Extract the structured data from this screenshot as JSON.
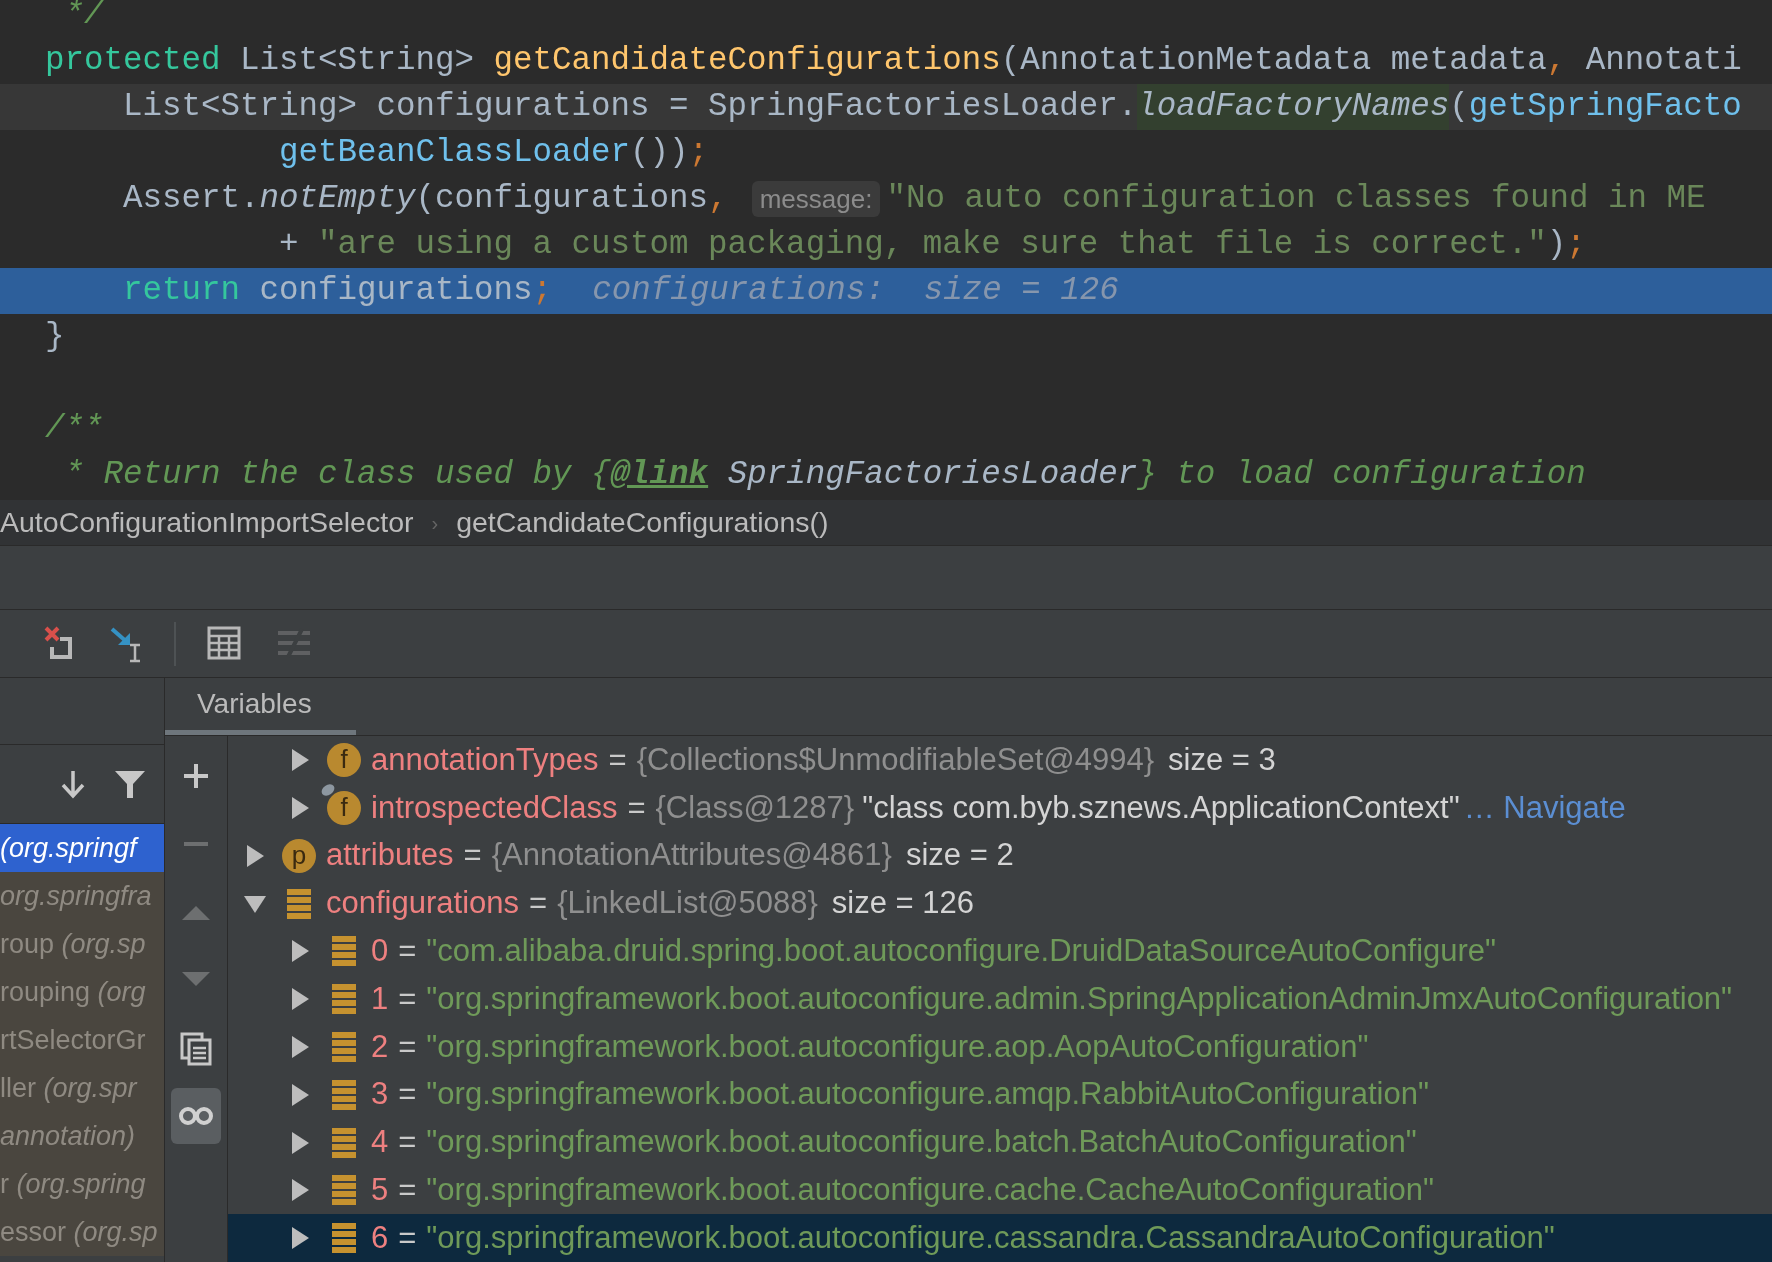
{
  "code": {
    "lines": [
      {
        "caret": false,
        "selected": false,
        "tokens": [
          {
            "kind": "comment",
            "text": " */"
          }
        ]
      },
      {
        "caret": false,
        "selected": false,
        "tokens": [
          {
            "kind": "keyword",
            "text": "protected"
          },
          {
            "kind": "plain",
            "text": " List<String> "
          },
          {
            "kind": "declaration",
            "text": "getCandidateConfigurations"
          },
          {
            "kind": "plain",
            "text": "(AnnotationMetadata metadata"
          },
          {
            "kind": "punct",
            "text": ","
          },
          {
            "kind": "plain",
            "text": " Annotati"
          }
        ]
      },
      {
        "caret": true,
        "selected": false,
        "tokens": [
          {
            "kind": "plain",
            "text": "    List<String> configurations = SpringFactoriesLoader."
          },
          {
            "kind": "italic-marked",
            "text": "loadFactoryNames"
          },
          {
            "kind": "plain",
            "text": "("
          },
          {
            "kind": "call",
            "text": "getSpringFacto"
          }
        ]
      },
      {
        "caret": false,
        "selected": false,
        "tokens": [
          {
            "kind": "call",
            "text": "            getBeanClassLoader"
          },
          {
            "kind": "plain",
            "text": "())"
          },
          {
            "kind": "punct",
            "text": ";"
          }
        ]
      },
      {
        "caret": false,
        "selected": false,
        "tokens": [
          {
            "kind": "plain",
            "text": "    Assert."
          },
          {
            "kind": "italic",
            "text": "notEmpty"
          },
          {
            "kind": "plain",
            "text": "(configurations"
          },
          {
            "kind": "punct",
            "text": ","
          },
          {
            "kind": "hint",
            "text": "message:"
          },
          {
            "kind": "string",
            "text": "\"No auto configuration classes found in ME"
          }
        ]
      },
      {
        "caret": false,
        "selected": false,
        "tokens": [
          {
            "kind": "plain",
            "text": "            + "
          },
          {
            "kind": "string",
            "text": "\"are using a custom packaging, make sure that file is correct.\""
          },
          {
            "kind": "plain",
            "text": ")"
          },
          {
            "kind": "punct",
            "text": ";"
          }
        ]
      },
      {
        "caret": false,
        "selected": true,
        "tokens": [
          {
            "kind": "keyword",
            "text": "    return"
          },
          {
            "kind": "plain",
            "text": " configurations"
          },
          {
            "kind": "punct",
            "text": ";"
          },
          {
            "kind": "debug",
            "text": "configurations:  size = 126"
          }
        ]
      },
      {
        "caret": false,
        "selected": false,
        "tokens": [
          {
            "kind": "plain",
            "text": "}"
          }
        ]
      },
      {
        "caret": false,
        "selected": false
      },
      {
        "caret": false,
        "selected": false,
        "tokens": [
          {
            "kind": "comment",
            "text": "/**"
          }
        ]
      },
      {
        "caret": false,
        "selected": false,
        "tokens": [
          {
            "kind": "comment",
            "text": " * Return the class used by {"
          },
          {
            "kind": "doc-tag",
            "text": "@link"
          },
          {
            "kind": "doc-ref",
            "text": " SpringFactoriesLoader"
          },
          {
            "kind": "comment",
            "text": "} to load configuration"
          }
        ]
      }
    ]
  },
  "breadcrumb": [
    {
      "text": "AutoConfigurationImportSelector",
      "separator": "›"
    },
    {
      "text": "getCandidateConfigurations()"
    }
  ],
  "toolbar": [
    {
      "kind": "drop-frame",
      "disabled": false
    },
    {
      "kind": "force-step",
      "disabled": false
    },
    {
      "kind": "separator"
    },
    {
      "kind": "evaluate",
      "disabled": false
    },
    {
      "kind": "trace",
      "disabled": true
    }
  ],
  "frames": [
    {
      "location": "(org.springf",
      "selected": true
    },
    {
      "location": "org.springfra",
      "selected": false
    },
    {
      "method": "roup ",
      "location": "(org.sp",
      "selected": false
    },
    {
      "method": "rouping ",
      "location": "(org",
      "selected": false
    },
    {
      "method": "rtSelectorGr",
      "selected": false
    },
    {
      "method": "ller ",
      "location": "(org.spr",
      "selected": false
    },
    {
      "location": "annotation)",
      "selected": false
    },
    {
      "method": "r ",
      "location": "(org.spring",
      "selected": false
    },
    {
      "method": "essor ",
      "location": "(org.sp",
      "selected": false
    }
  ],
  "side_tools": [
    {
      "kind": "add",
      "disabled": false,
      "on": false
    },
    {
      "kind": "remove",
      "disabled": true,
      "on": false
    },
    {
      "kind": "up",
      "disabled": true,
      "on": false
    },
    {
      "kind": "down",
      "disabled": true,
      "on": false
    },
    {
      "kind": "copy",
      "disabled": false,
      "on": false
    },
    {
      "kind": "watch",
      "disabled": false,
      "on": true
    }
  ],
  "tabs": [
    {
      "label": "Variables",
      "selected": true
    }
  ],
  "variables": [
    {
      "children": [
        {
          "name": "annotationTypes",
          "op": "=",
          "ref": "{Collections$UnmodifiableSet@4994}",
          "info": "size = 3",
          "icon": {
            "kind": "letter",
            "text": "f"
          },
          "pinned": false,
          "expanded": false,
          "selected": false
        },
        {
          "name": "introspectedClass",
          "op": "=",
          "ref": "{Class@1287}",
          "info": "\"class com.byb.sznews.ApplicationContext\"",
          "link": "… Navigate",
          "icon": {
            "kind": "letter",
            "text": "f"
          },
          "pinned": true,
          "expanded": false,
          "selected": false
        }
      ]
    },
    {
      "name": "attributes",
      "op": "=",
      "ref": "{AnnotationAttributes@4861}",
      "info": "size = 2",
      "icon": {
        "kind": "letter",
        "text": "p"
      },
      "pinned": false,
      "expanded": false,
      "selected": false
    },
    {
      "name": "configurations",
      "op": "=",
      "ref": "{LinkedList@5088}",
      "info": "size = 126",
      "icon": {
        "kind": "stack"
      },
      "pinned": false,
      "expanded": true,
      "selected": false,
      "children": [
        {
          "name": "0",
          "op": "=",
          "string": "\"com.alibaba.druid.spring.boot.autoconfigure.DruidDataSourceAutoConfigure\"",
          "icon": {
            "kind": "stack"
          },
          "pinned": false,
          "expanded": false,
          "selected": false
        },
        {
          "name": "1",
          "op": "=",
          "string": "\"org.springframework.boot.autoconfigure.admin.SpringApplicationAdminJmxAutoConfiguration\"",
          "icon": {
            "kind": "stack"
          },
          "pinned": false,
          "expanded": false,
          "selected": false
        },
        {
          "name": "2",
          "op": "=",
          "string": "\"org.springframework.boot.autoconfigure.aop.AopAutoConfiguration\"",
          "icon": {
            "kind": "stack"
          },
          "pinned": false,
          "expanded": false,
          "selected": false
        },
        {
          "name": "3",
          "op": "=",
          "string": "\"org.springframework.boot.autoconfigure.amqp.RabbitAutoConfiguration\"",
          "icon": {
            "kind": "stack"
          },
          "pinned": false,
          "expanded": false,
          "selected": false
        },
        {
          "name": "4",
          "op": "=",
          "string": "\"org.springframework.boot.autoconfigure.batch.BatchAutoConfiguration\"",
          "icon": {
            "kind": "stack"
          },
          "pinned": false,
          "expanded": false,
          "selected": false
        },
        {
          "name": "5",
          "op": "=",
          "string": "\"org.springframework.boot.autoconfigure.cache.CacheAutoConfiguration\"",
          "icon": {
            "kind": "stack"
          },
          "pinned": false,
          "expanded": false,
          "selected": false
        },
        {
          "name": "6",
          "op": "=",
          "string": "\"org.springframework.boot.autoconfigure.cassandra.CassandraAutoConfiguration\"",
          "icon": {
            "kind": "stack"
          },
          "pinned": false,
          "expanded": false,
          "selected": true
        }
      ]
    }
  ]
}
